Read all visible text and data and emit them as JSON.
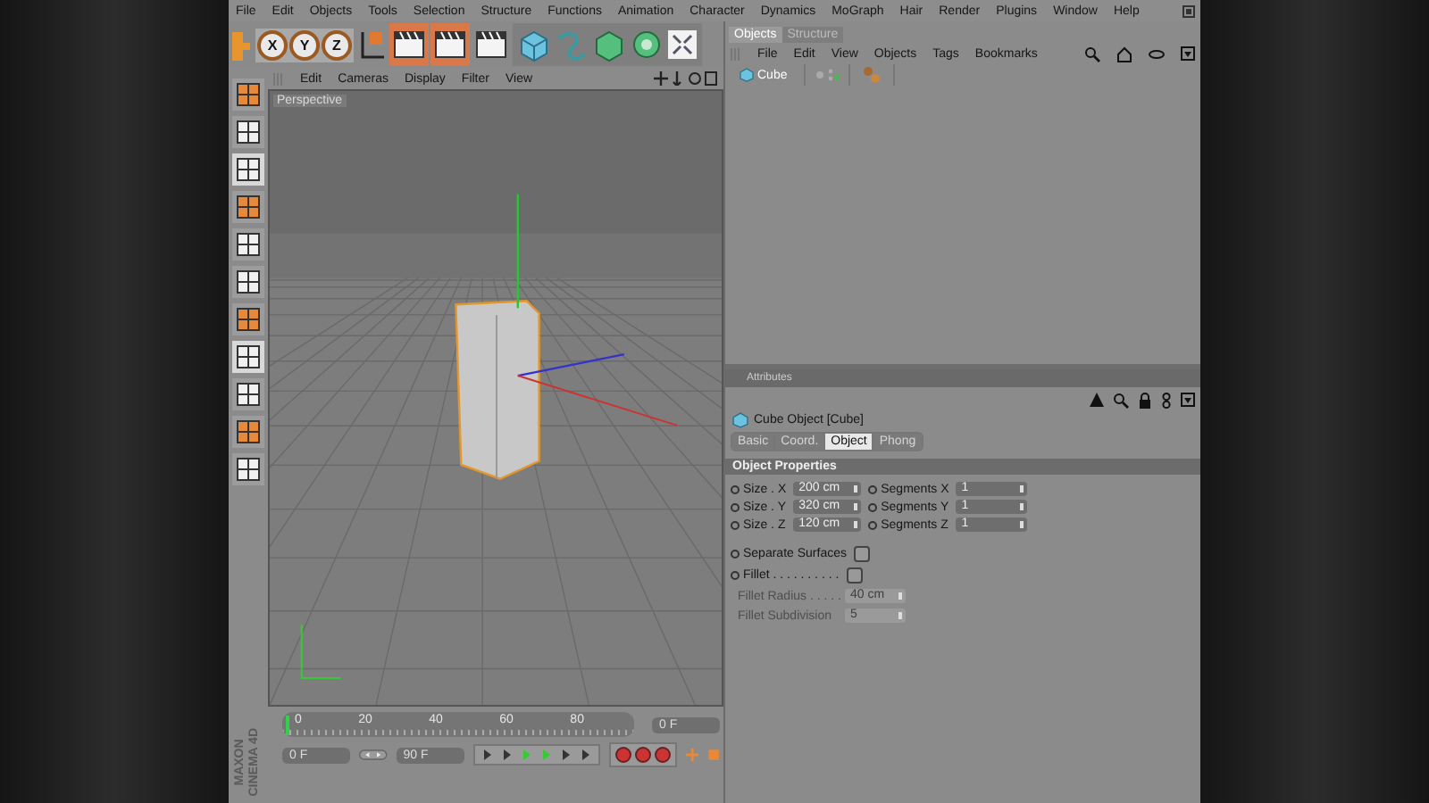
{
  "menu_bar": [
    "File",
    "Edit",
    "Objects",
    "Tools",
    "Selection",
    "Structure",
    "Functions",
    "Animation",
    "Character",
    "Dynamics",
    "MoGraph",
    "Hair",
    "Render",
    "Plugins",
    "Window",
    "Help"
  ],
  "toolbar": {
    "axis_buttons": [
      "X",
      "Y",
      "Z"
    ]
  },
  "viewport": {
    "menu": [
      "Edit",
      "Cameras",
      "Display",
      "Filter",
      "View"
    ],
    "camera_label": "Perspective"
  },
  "objects_panel": {
    "tabs": [
      {
        "label": "Objects",
        "selected": true
      },
      {
        "label": "Structure",
        "selected": false
      }
    ],
    "menu": [
      "File",
      "Edit",
      "View",
      "Objects",
      "Tags",
      "Bookmarks"
    ],
    "items": [
      {
        "name": "Cube",
        "selected": true
      }
    ]
  },
  "attributes_panel": {
    "title": "Attributes",
    "object_title": "Cube Object [Cube]",
    "tabs": [
      {
        "label": "Basic",
        "selected": false
      },
      {
        "label": "Coord.",
        "selected": false
      },
      {
        "label": "Object",
        "selected": true
      },
      {
        "label": "Phong",
        "selected": false
      }
    ],
    "section": "Object Properties",
    "size_rows": [
      {
        "label": "Size . X",
        "value": "200 cm",
        "seg_label": "Segments X",
        "seg_value": "1"
      },
      {
        "label": "Size . Y",
        "value": "320 cm",
        "seg_label": "Segments Y",
        "seg_value": "1"
      },
      {
        "label": "Size . Z",
        "value": "120 cm",
        "seg_label": "Segments Z",
        "seg_value": "1"
      }
    ],
    "options": [
      {
        "label": "Separate Surfaces",
        "checked": false
      },
      {
        "label": "Fillet . . . . . . . . . .",
        "checked": false
      }
    ],
    "disabled_fields": [
      {
        "label": "Fillet Radius . . . . .",
        "value": "40 cm",
        "disabled": true
      },
      {
        "label": "Fillet Subdivision",
        "value": "5",
        "disabled": true
      }
    ]
  },
  "timeline": {
    "ticks": [
      "0",
      "20",
      "40",
      "60",
      "80"
    ],
    "playhead": {
      "level": 0
    },
    "current_frame": "0 F",
    "start_frame": "0 F",
    "end_frame": "90 F"
  },
  "logo": {
    "brand": "MAXON",
    "product": "CINEMA 4D"
  }
}
